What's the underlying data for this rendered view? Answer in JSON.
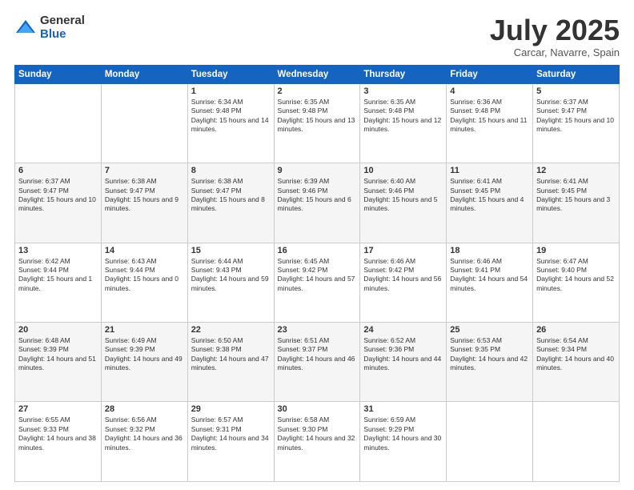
{
  "logo": {
    "general": "General",
    "blue": "Blue"
  },
  "header": {
    "month": "July 2025",
    "location": "Carcar, Navarre, Spain"
  },
  "weekdays": [
    "Sunday",
    "Monday",
    "Tuesday",
    "Wednesday",
    "Thursday",
    "Friday",
    "Saturday"
  ],
  "weeks": [
    [
      {
        "day": "",
        "sunrise": "",
        "sunset": "",
        "daylight": ""
      },
      {
        "day": "",
        "sunrise": "",
        "sunset": "",
        "daylight": ""
      },
      {
        "day": "1",
        "sunrise": "Sunrise: 6:34 AM",
        "sunset": "Sunset: 9:48 PM",
        "daylight": "Daylight: 15 hours and 14 minutes."
      },
      {
        "day": "2",
        "sunrise": "Sunrise: 6:35 AM",
        "sunset": "Sunset: 9:48 PM",
        "daylight": "Daylight: 15 hours and 13 minutes."
      },
      {
        "day": "3",
        "sunrise": "Sunrise: 6:35 AM",
        "sunset": "Sunset: 9:48 PM",
        "daylight": "Daylight: 15 hours and 12 minutes."
      },
      {
        "day": "4",
        "sunrise": "Sunrise: 6:36 AM",
        "sunset": "Sunset: 9:48 PM",
        "daylight": "Daylight: 15 hours and 11 minutes."
      },
      {
        "day": "5",
        "sunrise": "Sunrise: 6:37 AM",
        "sunset": "Sunset: 9:47 PM",
        "daylight": "Daylight: 15 hours and 10 minutes."
      }
    ],
    [
      {
        "day": "6",
        "sunrise": "Sunrise: 6:37 AM",
        "sunset": "Sunset: 9:47 PM",
        "daylight": "Daylight: 15 hours and 10 minutes."
      },
      {
        "day": "7",
        "sunrise": "Sunrise: 6:38 AM",
        "sunset": "Sunset: 9:47 PM",
        "daylight": "Daylight: 15 hours and 9 minutes."
      },
      {
        "day": "8",
        "sunrise": "Sunrise: 6:38 AM",
        "sunset": "Sunset: 9:47 PM",
        "daylight": "Daylight: 15 hours and 8 minutes."
      },
      {
        "day": "9",
        "sunrise": "Sunrise: 6:39 AM",
        "sunset": "Sunset: 9:46 PM",
        "daylight": "Daylight: 15 hours and 6 minutes."
      },
      {
        "day": "10",
        "sunrise": "Sunrise: 6:40 AM",
        "sunset": "Sunset: 9:46 PM",
        "daylight": "Daylight: 15 hours and 5 minutes."
      },
      {
        "day": "11",
        "sunrise": "Sunrise: 6:41 AM",
        "sunset": "Sunset: 9:45 PM",
        "daylight": "Daylight: 15 hours and 4 minutes."
      },
      {
        "day": "12",
        "sunrise": "Sunrise: 6:41 AM",
        "sunset": "Sunset: 9:45 PM",
        "daylight": "Daylight: 15 hours and 3 minutes."
      }
    ],
    [
      {
        "day": "13",
        "sunrise": "Sunrise: 6:42 AM",
        "sunset": "Sunset: 9:44 PM",
        "daylight": "Daylight: 15 hours and 1 minute."
      },
      {
        "day": "14",
        "sunrise": "Sunrise: 6:43 AM",
        "sunset": "Sunset: 9:44 PM",
        "daylight": "Daylight: 15 hours and 0 minutes."
      },
      {
        "day": "15",
        "sunrise": "Sunrise: 6:44 AM",
        "sunset": "Sunset: 9:43 PM",
        "daylight": "Daylight: 14 hours and 59 minutes."
      },
      {
        "day": "16",
        "sunrise": "Sunrise: 6:45 AM",
        "sunset": "Sunset: 9:42 PM",
        "daylight": "Daylight: 14 hours and 57 minutes."
      },
      {
        "day": "17",
        "sunrise": "Sunrise: 6:46 AM",
        "sunset": "Sunset: 9:42 PM",
        "daylight": "Daylight: 14 hours and 56 minutes."
      },
      {
        "day": "18",
        "sunrise": "Sunrise: 6:46 AM",
        "sunset": "Sunset: 9:41 PM",
        "daylight": "Daylight: 14 hours and 54 minutes."
      },
      {
        "day": "19",
        "sunrise": "Sunrise: 6:47 AM",
        "sunset": "Sunset: 9:40 PM",
        "daylight": "Daylight: 14 hours and 52 minutes."
      }
    ],
    [
      {
        "day": "20",
        "sunrise": "Sunrise: 6:48 AM",
        "sunset": "Sunset: 9:39 PM",
        "daylight": "Daylight: 14 hours and 51 minutes."
      },
      {
        "day": "21",
        "sunrise": "Sunrise: 6:49 AM",
        "sunset": "Sunset: 9:39 PM",
        "daylight": "Daylight: 14 hours and 49 minutes."
      },
      {
        "day": "22",
        "sunrise": "Sunrise: 6:50 AM",
        "sunset": "Sunset: 9:38 PM",
        "daylight": "Daylight: 14 hours and 47 minutes."
      },
      {
        "day": "23",
        "sunrise": "Sunrise: 6:51 AM",
        "sunset": "Sunset: 9:37 PM",
        "daylight": "Daylight: 14 hours and 46 minutes."
      },
      {
        "day": "24",
        "sunrise": "Sunrise: 6:52 AM",
        "sunset": "Sunset: 9:36 PM",
        "daylight": "Daylight: 14 hours and 44 minutes."
      },
      {
        "day": "25",
        "sunrise": "Sunrise: 6:53 AM",
        "sunset": "Sunset: 9:35 PM",
        "daylight": "Daylight: 14 hours and 42 minutes."
      },
      {
        "day": "26",
        "sunrise": "Sunrise: 6:54 AM",
        "sunset": "Sunset: 9:34 PM",
        "daylight": "Daylight: 14 hours and 40 minutes."
      }
    ],
    [
      {
        "day": "27",
        "sunrise": "Sunrise: 6:55 AM",
        "sunset": "Sunset: 9:33 PM",
        "daylight": "Daylight: 14 hours and 38 minutes."
      },
      {
        "day": "28",
        "sunrise": "Sunrise: 6:56 AM",
        "sunset": "Sunset: 9:32 PM",
        "daylight": "Daylight: 14 hours and 36 minutes."
      },
      {
        "day": "29",
        "sunrise": "Sunrise: 6:57 AM",
        "sunset": "Sunset: 9:31 PM",
        "daylight": "Daylight: 14 hours and 34 minutes."
      },
      {
        "day": "30",
        "sunrise": "Sunrise: 6:58 AM",
        "sunset": "Sunset: 9:30 PM",
        "daylight": "Daylight: 14 hours and 32 minutes."
      },
      {
        "day": "31",
        "sunrise": "Sunrise: 6:59 AM",
        "sunset": "Sunset: 9:29 PM",
        "daylight": "Daylight: 14 hours and 30 minutes."
      },
      {
        "day": "",
        "sunrise": "",
        "sunset": "",
        "daylight": ""
      },
      {
        "day": "",
        "sunrise": "",
        "sunset": "",
        "daylight": ""
      }
    ]
  ]
}
